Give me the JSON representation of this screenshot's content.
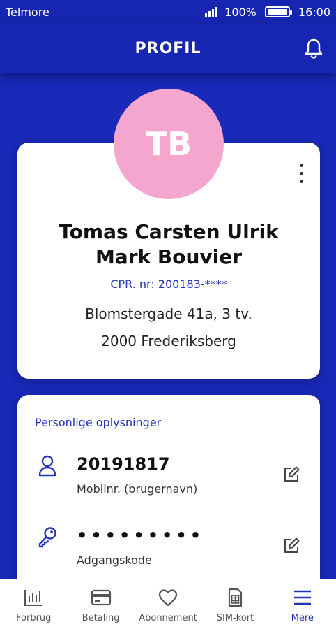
{
  "status_bar": {
    "carrier": "Telmore",
    "battery": "100%",
    "time": "16:00"
  },
  "header": {
    "title": "PROFIL",
    "notification_icon": "bell-icon"
  },
  "profile": {
    "initials": "TB",
    "avatar_color": "#f4a6cf",
    "name_line1": "Tomas Carsten Ulrik",
    "name_line2": "Mark Bouvier",
    "cpr": "CPR. nr: 200183-****",
    "address_line1": "Blomstergade 41a, 3 tv.",
    "address_line2": "2000 Frederiksberg"
  },
  "personal_info": {
    "section_title": "Personlige oplysninger",
    "rows": [
      {
        "icon": "user-icon",
        "value": "20191817",
        "label": "Mobilnr. (brugernavn)"
      },
      {
        "icon": "key-icon",
        "value": "•••••••••",
        "label": "Adgangskode"
      }
    ]
  },
  "bottom_nav": {
    "items": [
      {
        "label": "Forbrug",
        "icon": "bar-chart-icon"
      },
      {
        "label": "Betaling",
        "icon": "credit-card-icon"
      },
      {
        "label": "Abonnement",
        "icon": "heart-icon"
      },
      {
        "label": "SIM-kort",
        "icon": "sim-card-icon"
      },
      {
        "label": "Mere",
        "icon": "menu-icon",
        "active": true
      }
    ]
  },
  "colors": {
    "background": "#1929b8",
    "accent": "#2233b8",
    "card": "#ffffff"
  }
}
